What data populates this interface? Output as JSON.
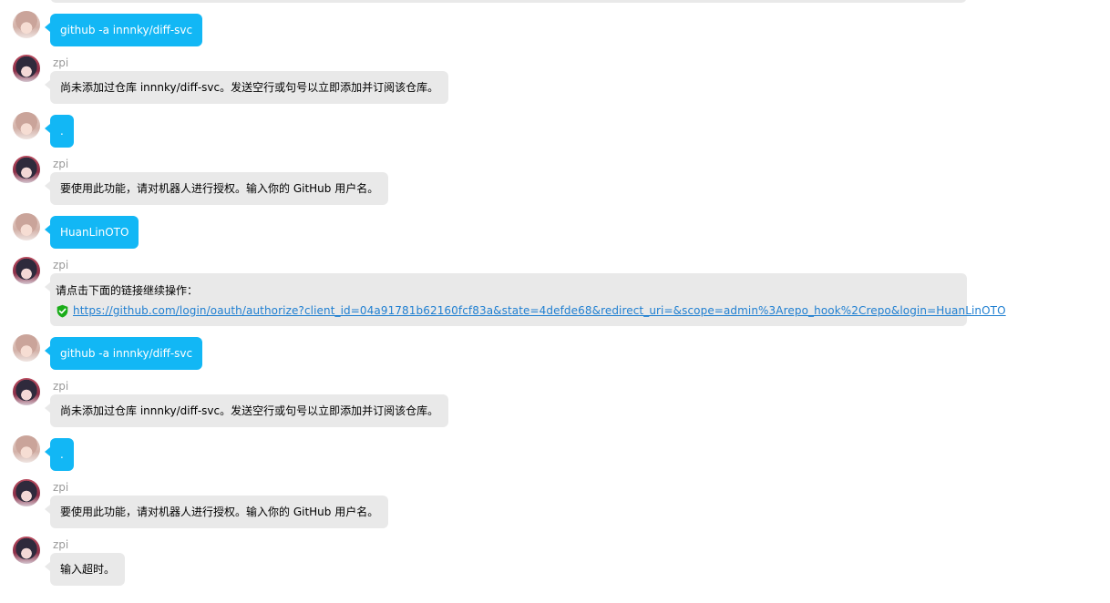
{
  "messages": [
    {
      "from": "user",
      "text": "github -a innnky/diff-svc"
    },
    {
      "from": "bot",
      "sender": "zpi",
      "text": "尚未添加过仓库 innnky/diff-svc。发送空行或句号以立即添加并订阅该仓库。"
    },
    {
      "from": "user",
      "text": "."
    },
    {
      "from": "bot",
      "sender": "zpi",
      "text": "要使用此功能，请对机器人进行授权。输入你的 GitHub 用户名。"
    },
    {
      "from": "user",
      "text": "HuanLinOTO"
    },
    {
      "from": "bot",
      "sender": "zpi",
      "text": "请点击下面的链接继续操作：",
      "link": "https://github.com/login/oauth/authorize?client_id=04a91781b62160fcf83a&state=4defde68&redirect_uri=&scope=admin%3Arepo_hook%2Crepo&login=HuanLinOTO",
      "link_icon": "verified-shield-icon"
    },
    {
      "from": "user",
      "text": "github -a innnky/diff-svc"
    },
    {
      "from": "bot",
      "sender": "zpi",
      "text": "尚未添加过仓库 innnky/diff-svc。发送空行或句号以立即添加并订阅该仓库。"
    },
    {
      "from": "user",
      "text": "."
    },
    {
      "from": "bot",
      "sender": "zpi",
      "text": "要使用此功能，请对机器人进行授权。输入你的 GitHub 用户名。"
    },
    {
      "from": "bot",
      "sender": "zpi",
      "text": "输入超时。"
    }
  ],
  "colors": {
    "user_bubble": "#12b7f5",
    "bot_bubble": "#e9e9e9",
    "link": "#1f7fd1",
    "shield": "#1aad19"
  }
}
